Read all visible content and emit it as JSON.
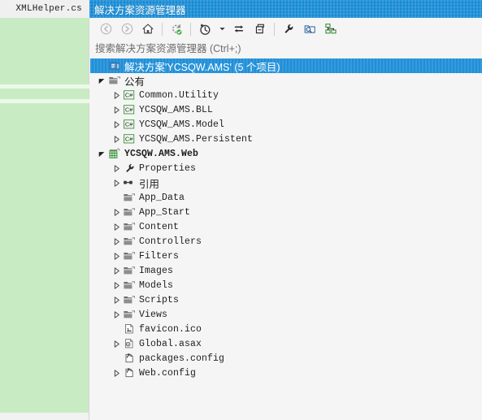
{
  "tabs": {
    "inactive": {
      "label": "XMLHelper.cs",
      "name": "tab-xmlhelper-cs"
    },
    "active": {
      "label": "解决方案资源管理器",
      "name": "tab-solution-explorer"
    }
  },
  "toolbar": {
    "buttons": [
      {
        "name": "back-arrow-icon",
        "title": "后退"
      },
      {
        "name": "forward-arrow-icon",
        "title": "前进"
      },
      {
        "name": "home-icon",
        "title": "主页"
      },
      {
        "name": "sync-with-active-document-icon",
        "title": "与活动文档同步"
      },
      {
        "name": "pending-changes-filter-icon",
        "title": "挂起的更改筛选器"
      },
      {
        "name": "chevron-down-icon",
        "title": "更多"
      },
      {
        "name": "refresh-icon",
        "title": "刷新"
      },
      {
        "name": "collapse-all-icon",
        "title": "全部折叠"
      },
      {
        "name": "properties-wrench-icon",
        "title": "属性"
      },
      {
        "name": "show-all-files-icon",
        "title": "显示所有文件"
      },
      {
        "name": "view-class-diagram-icon",
        "title": "查看类关系图"
      }
    ]
  },
  "search": {
    "placeholder": "搜索解决方案资源管理器 (Ctrl+;)",
    "value": ""
  },
  "colors": {
    "accent_blue": "#1389d4",
    "selection_blue": "#1f8fd8",
    "editor_green": "#c9ebc4",
    "panel_bg": "#f5f5f5"
  },
  "tree": {
    "nodes": [
      {
        "label": "解决方案'YCSQW.AMS' (5 个项目)",
        "cjk": true,
        "bold": false,
        "depth": 0,
        "expander": "none",
        "icon": "solution-icon",
        "selected": true,
        "name": "tree-node-solution"
      },
      {
        "label": "公有",
        "cjk": true,
        "bold": false,
        "depth": 0,
        "expander": "expanded",
        "icon": "solution-folder-icon",
        "selected": false,
        "name": "tree-node-solution-folder-gongyou"
      },
      {
        "label": "Common.Utility",
        "cjk": false,
        "bold": false,
        "depth": 1,
        "expander": "collapsed",
        "icon": "csharp-project-icon",
        "selected": false,
        "name": "tree-node-project-common-utility"
      },
      {
        "label": "YCSQW_AMS.BLL",
        "cjk": false,
        "bold": false,
        "depth": 1,
        "expander": "collapsed",
        "icon": "csharp-project-icon",
        "selected": false,
        "name": "tree-node-project-ycsqw-ams-bll"
      },
      {
        "label": "YCSQW_AMS.Model",
        "cjk": false,
        "bold": false,
        "depth": 1,
        "expander": "collapsed",
        "icon": "csharp-project-icon",
        "selected": false,
        "name": "tree-node-project-ycsqw-ams-model"
      },
      {
        "label": "YCSQW_AMS.Persistent",
        "cjk": false,
        "bold": false,
        "depth": 1,
        "expander": "collapsed",
        "icon": "csharp-project-icon",
        "selected": false,
        "name": "tree-node-project-ycsqw-ams-persistent"
      },
      {
        "label": "YCSQW.AMS.Web",
        "cjk": false,
        "bold": true,
        "depth": 0,
        "expander": "expanded",
        "icon": "web-project-icon",
        "selected": false,
        "name": "tree-node-project-ycsqw-ams-web"
      },
      {
        "label": "Properties",
        "cjk": false,
        "bold": false,
        "depth": 1,
        "expander": "collapsed",
        "icon": "properties-wrench-icon",
        "selected": false,
        "name": "tree-node-properties"
      },
      {
        "label": "引用",
        "cjk": true,
        "bold": false,
        "depth": 1,
        "expander": "collapsed",
        "icon": "references-icon",
        "selected": false,
        "name": "tree-node-references"
      },
      {
        "label": "App_Data",
        "cjk": false,
        "bold": false,
        "depth": 1,
        "expander": "none",
        "icon": "folder-icon",
        "selected": false,
        "name": "tree-node-folder-app-data"
      },
      {
        "label": "App_Start",
        "cjk": false,
        "bold": false,
        "depth": 1,
        "expander": "collapsed",
        "icon": "folder-icon",
        "selected": false,
        "name": "tree-node-folder-app-start"
      },
      {
        "label": "Content",
        "cjk": false,
        "bold": false,
        "depth": 1,
        "expander": "collapsed",
        "icon": "folder-icon",
        "selected": false,
        "name": "tree-node-folder-content"
      },
      {
        "label": "Controllers",
        "cjk": false,
        "bold": false,
        "depth": 1,
        "expander": "collapsed",
        "icon": "folder-icon",
        "selected": false,
        "name": "tree-node-folder-controllers"
      },
      {
        "label": "Filters",
        "cjk": false,
        "bold": false,
        "depth": 1,
        "expander": "collapsed",
        "icon": "folder-icon",
        "selected": false,
        "name": "tree-node-folder-filters"
      },
      {
        "label": "Images",
        "cjk": false,
        "bold": false,
        "depth": 1,
        "expander": "collapsed",
        "icon": "folder-icon",
        "selected": false,
        "name": "tree-node-folder-images"
      },
      {
        "label": "Models",
        "cjk": false,
        "bold": false,
        "depth": 1,
        "expander": "collapsed",
        "icon": "folder-icon",
        "selected": false,
        "name": "tree-node-folder-models"
      },
      {
        "label": "Scripts",
        "cjk": false,
        "bold": false,
        "depth": 1,
        "expander": "collapsed",
        "icon": "folder-icon",
        "selected": false,
        "name": "tree-node-folder-scripts"
      },
      {
        "label": "Views",
        "cjk": false,
        "bold": false,
        "depth": 1,
        "expander": "collapsed",
        "icon": "folder-icon",
        "selected": false,
        "name": "tree-node-folder-views"
      },
      {
        "label": "favicon.ico",
        "cjk": false,
        "bold": false,
        "depth": 1,
        "expander": "none",
        "icon": "image-file-icon",
        "selected": false,
        "name": "tree-node-file-favicon-ico"
      },
      {
        "label": "Global.asax",
        "cjk": false,
        "bold": false,
        "depth": 1,
        "expander": "collapsed",
        "icon": "asax-file-icon",
        "selected": false,
        "name": "tree-node-file-global-asax"
      },
      {
        "label": "packages.config",
        "cjk": false,
        "bold": false,
        "depth": 1,
        "expander": "none",
        "icon": "config-file-icon",
        "selected": false,
        "name": "tree-node-file-packages-config"
      },
      {
        "label": "Web.config",
        "cjk": false,
        "bold": false,
        "depth": 1,
        "expander": "collapsed",
        "icon": "config-file-icon",
        "selected": false,
        "name": "tree-node-file-web-config"
      }
    ]
  }
}
